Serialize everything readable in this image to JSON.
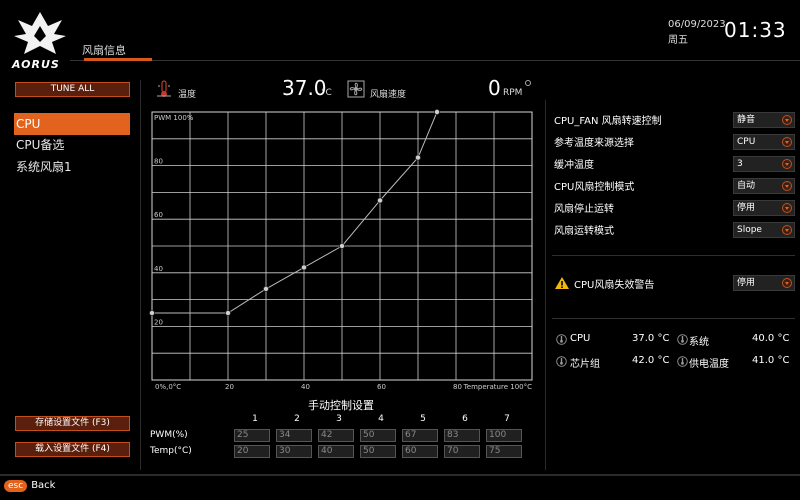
{
  "header": {
    "brand": "AORUS",
    "tab": "风扇信息",
    "date": "06/09/2023",
    "weekday": "周五",
    "time": "01:33"
  },
  "left_panel": {
    "tune_all": "TUNE ALL",
    "fans": [
      {
        "label": "CPU",
        "selected": true
      },
      {
        "label": "CPU备选",
        "selected": false
      },
      {
        "label": "系统风扇1",
        "selected": false
      }
    ],
    "save_profile": "存储设置文件 (F3)",
    "load_profile": "载入设置文件 (F4)"
  },
  "readout": {
    "temp_label": "温度",
    "temp_value": "37.0",
    "temp_unit": "°C",
    "fan_label": "风扇速度",
    "fan_value": "0",
    "fan_unit": "RPM"
  },
  "chart_data": {
    "type": "line",
    "y_axis_title": "PWM 100%",
    "x_axis_title": "Temperature 100°C",
    "origin_label": "0%,0°C",
    "y_ticks": [
      "20",
      "40",
      "60",
      "80"
    ],
    "x_ticks": [
      "20",
      "40",
      "60",
      "80"
    ],
    "xlim": [
      0,
      100
    ],
    "ylim": [
      0,
      100
    ],
    "grid": true,
    "series": [
      {
        "x": [
          0,
          20,
          30,
          40,
          50,
          60,
          70,
          75
        ],
        "y": [
          25,
          25,
          34,
          42,
          50,
          67,
          83,
          100
        ]
      }
    ],
    "accent": "#bbbbbb"
  },
  "manual": {
    "title": "手动控制设置",
    "columns": [
      "1",
      "2",
      "3",
      "4",
      "5",
      "6",
      "7"
    ],
    "pwm_label": "PWM(%)",
    "temp_label": "Temp(°C)",
    "pwm": [
      "25",
      "34",
      "42",
      "50",
      "67",
      "83",
      "100"
    ],
    "temp": [
      "20",
      "30",
      "40",
      "50",
      "60",
      "70",
      "75"
    ]
  },
  "settings": [
    {
      "label": "CPU_FAN 风扇转速控制",
      "value": "静音"
    },
    {
      "label": "参考温度来源选择",
      "value": "CPU"
    },
    {
      "label": "缓冲温度",
      "value": "3"
    },
    {
      "label": "CPU风扇控制模式",
      "value": "自动"
    },
    {
      "label": "风扇停止运转",
      "value": "停用"
    },
    {
      "label": "风扇运转模式",
      "value": "Slope"
    }
  ],
  "warning": {
    "label": "CPU风扇失效警告",
    "value": "停用"
  },
  "monitor": [
    {
      "label": "CPU",
      "value": "37.0 °C",
      "icon": "thermometer-icon"
    },
    {
      "label": "系统",
      "value": "40.0 °C",
      "icon": "thermometer-icon"
    },
    {
      "label": "芯片组",
      "value": "42.0 °C",
      "icon": "thermometer-icon"
    },
    {
      "label": "供电温度",
      "value": "41.0 °C",
      "icon": "thermometer-icon"
    }
  ],
  "footer": {
    "esc": "esc",
    "back": "Back"
  },
  "colors": {
    "accent": "#e2631d",
    "dark_accent": "#5a1f0d"
  }
}
